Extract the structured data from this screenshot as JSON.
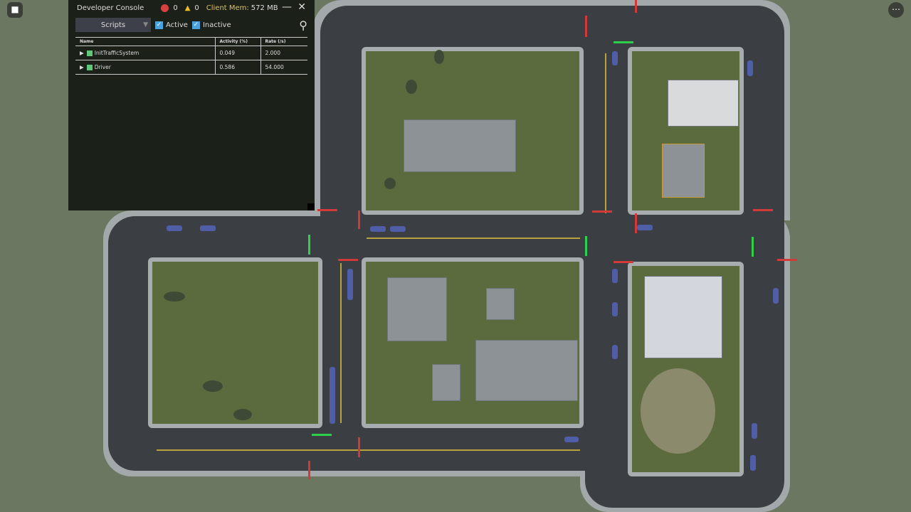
{
  "console": {
    "title": "Developer Console",
    "errors": "0",
    "warnings": "0",
    "mem_label": "Client Mem:",
    "mem_value": "572 MB",
    "view": "Scripts",
    "active_label": "Active",
    "inactive_label": "Inactive",
    "columns": [
      "Name",
      "Activity (%)",
      "Rate (/s)"
    ],
    "rows": [
      {
        "name": "InitTrafficSystem",
        "activity": "0.049",
        "rate": "2.000"
      },
      {
        "name": "Driver",
        "activity": "0.586",
        "rate": "54.000"
      }
    ]
  },
  "colors": {
    "road": "#3b3e42",
    "grass": "#5b6b3e",
    "sidewalk": "#a7acaf",
    "signal_red": "#d23a3a",
    "signal_green": "#2fd04a"
  }
}
